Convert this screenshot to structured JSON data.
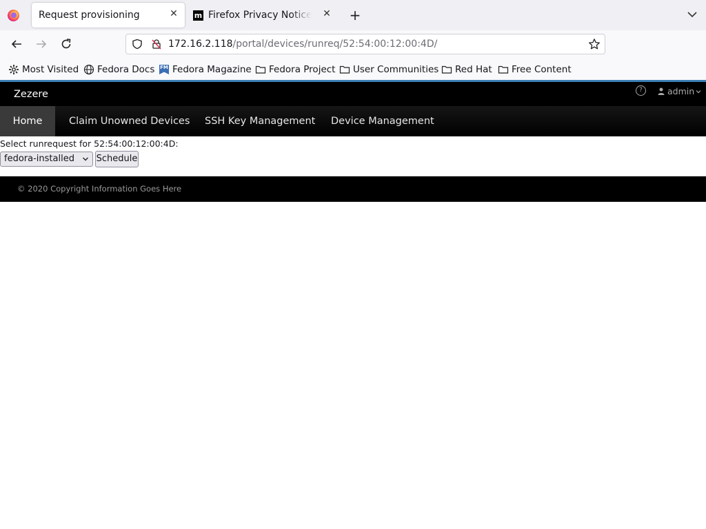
{
  "browser": {
    "tabs": [
      {
        "title": "Request provisioning",
        "active": true
      },
      {
        "title": "Firefox Privacy Notice — Mozilla",
        "active": false
      }
    ],
    "url_host": "172.16.2.118",
    "url_path": "/portal/devices/runreq/52:54:00:12:00:4D/",
    "bookmarks": [
      {
        "label": "Most Visited",
        "icon": "gear-icon"
      },
      {
        "label": "Fedora Docs",
        "icon": "globe-icon"
      },
      {
        "label": "Fedora Magazine",
        "icon": "fedora-magazine-icon"
      },
      {
        "label": "Fedora Project",
        "icon": "folder-icon"
      },
      {
        "label": "User Communities",
        "icon": "folder-icon"
      },
      {
        "label": "Red Hat",
        "icon": "folder-icon"
      },
      {
        "label": "Free Content",
        "icon": "folder-icon"
      }
    ],
    "fm_badge": "FM"
  },
  "app": {
    "brand": "Zezere",
    "help_symbol": "?",
    "user": "admin",
    "nav": [
      {
        "label": "Home",
        "active": true
      },
      {
        "label": "Claim Unowned Devices",
        "active": false
      },
      {
        "label": "SSH Key Management",
        "active": false
      },
      {
        "label": "Device Management",
        "active": false
      }
    ],
    "form": {
      "label": "Select runrequest for 52:54:00:12:00:4D:",
      "selected_option": "fedora-installed",
      "submit_label": "Schedule"
    },
    "footer": "© 2020 Copyright Information Goes Here"
  },
  "colors": {
    "header_accent": "#3d7eb6",
    "header_bg": "#000000",
    "nav_active_bg": "#3a3a3a"
  }
}
